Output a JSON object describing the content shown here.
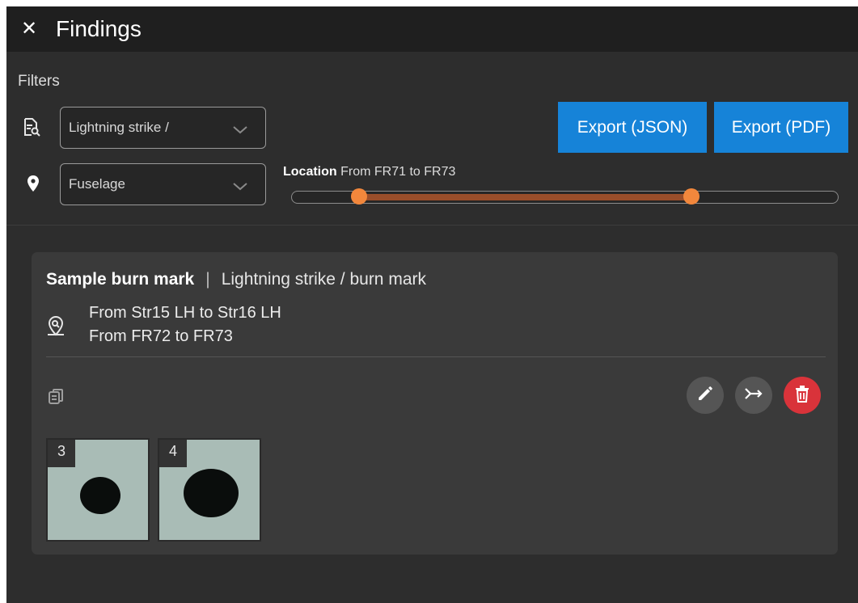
{
  "header": {
    "title": "Findings",
    "close_icon": "close-icon"
  },
  "filters": {
    "label": "Filters",
    "type_filter": {
      "icon": "document-search-icon",
      "value": "Lightning strike /"
    },
    "zone_filter": {
      "icon": "map-pin-icon",
      "value": "Fuselage"
    },
    "export_json_label": "Export (JSON)",
    "export_pdf_label": "Export (PDF)",
    "location": {
      "label": "Location",
      "range_text": "From FR71 to FR73",
      "range_start_fraction": 0.123,
      "range_end_fraction": 0.732
    }
  },
  "finding": {
    "name": "Sample burn mark",
    "separator": "|",
    "category": "Lightning strike / burn mark",
    "location_icon": "location-search-icon",
    "stringer_range": "From Str15 LH to Str16 LH",
    "frame_range": "From FR72 to FR73",
    "actions": {
      "copy_icon": "copy-icon",
      "edit_icon": "pencil-icon",
      "merge_icon": "merge-icon",
      "delete_icon": "trash-icon"
    },
    "photos": [
      {
        "number": "3"
      },
      {
        "number": "4"
      }
    ]
  },
  "colors": {
    "accent": "#1683d8",
    "slider": "#f2873c",
    "delete": "#d9333a",
    "panel_bg": "#2d2d2d",
    "card_bg": "#3a3a3a"
  }
}
